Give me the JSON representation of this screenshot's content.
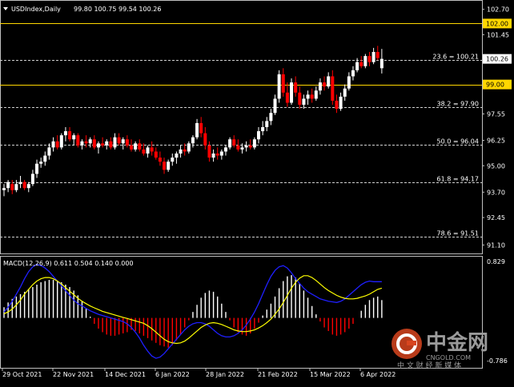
{
  "header": {
    "symbol": "USDIndex,Daily",
    "ohlc": "99.80 100.75 99.54 100.26"
  },
  "macd_header": "MACD(12,26,9) 0.611 0.504 0.140 0.000",
  "colors": {
    "background": "#000000",
    "bull": "#ffffff",
    "bear": "#ff0000",
    "macd_signal": "#ffff00",
    "macd_line": "#1f1fff",
    "level_line": "#ffd700",
    "hist_pos": "#ffffff",
    "hist_neg": "#ff0000"
  },
  "price_axis": {
    "ticks": [
      "102.70",
      "101.45",
      "97.55",
      "96.25",
      "95.00",
      "93.70",
      "92.45",
      "91.10"
    ],
    "current": "100.26",
    "levels": [
      "102.00",
      "99.00"
    ]
  },
  "fib_levels": [
    {
      "label": "23.6 = 100.21",
      "value": 100.21
    },
    {
      "label": "38.2 = 97.90",
      "value": 97.9
    },
    {
      "label": "50.0 = 96.04",
      "value": 96.04
    },
    {
      "label": "61.8 = 94.17",
      "value": 94.17
    },
    {
      "label": "78.6 = 91.51",
      "value": 91.51
    }
  ],
  "macd_axis": {
    "top": "0.829",
    "bottom": "-0.786"
  },
  "date_axis": [
    "29 Oct 2021",
    "22 Nov 2021",
    "14 Dec 2021",
    "6 Jan 2022",
    "28 Jan 2022",
    "21 Feb 2022",
    "15 Mar 2022",
    "6 Apr 2022"
  ],
  "watermark": {
    "name": "中金网",
    "domain": "CNGOLD.COM",
    "tagline": "中 文 财 经 新 媒 体"
  },
  "chart_data": {
    "type": "candlestick",
    "ylim": [
      90.8,
      103.0
    ],
    "candles": [
      [
        93.8,
        94.1,
        93.5,
        93.9
      ],
      [
        93.9,
        94.3,
        93.7,
        94.2
      ],
      [
        94.1,
        94.3,
        93.6,
        93.8
      ],
      [
        93.8,
        94.3,
        93.7,
        94.1
      ],
      [
        94.1,
        94.5,
        93.9,
        94.2
      ],
      [
        94.2,
        94.3,
        93.8,
        93.9
      ],
      [
        93.9,
        94.2,
        93.7,
        94.1
      ],
      [
        94.1,
        94.8,
        94.0,
        94.6
      ],
      [
        94.6,
        95.3,
        94.4,
        95.1
      ],
      [
        95.1,
        95.4,
        94.9,
        95.2
      ],
      [
        95.2,
        95.7,
        95.0,
        95.5
      ],
      [
        95.5,
        96.1,
        95.3,
        95.9
      ],
      [
        95.9,
        96.4,
        95.7,
        96.2
      ],
      [
        96.2,
        96.5,
        95.8,
        95.9
      ],
      [
        95.9,
        96.6,
        95.8,
        96.5
      ],
      [
        96.5,
        96.9,
        96.2,
        96.7
      ],
      [
        96.7,
        96.9,
        96.2,
        96.3
      ],
      [
        96.3,
        96.6,
        96.0,
        96.5
      ],
      [
        96.5,
        96.6,
        95.9,
        96.0
      ],
      [
        96.0,
        96.3,
        95.8,
        96.2
      ],
      [
        96.2,
        96.5,
        95.9,
        96.1
      ],
      [
        96.1,
        96.4,
        95.9,
        96.3
      ],
      [
        96.3,
        96.5,
        95.8,
        95.9
      ],
      [
        95.9,
        96.2,
        95.6,
        96.1
      ],
      [
        96.1,
        96.4,
        95.9,
        96.0
      ],
      [
        96.0,
        96.3,
        95.8,
        96.2
      ],
      [
        96.2,
        96.4,
        95.8,
        95.9
      ],
      [
        95.9,
        96.6,
        95.8,
        96.4
      ],
      [
        96.4,
        96.6,
        96.0,
        96.1
      ],
      [
        96.1,
        96.4,
        95.8,
        96.3
      ],
      [
        96.3,
        96.5,
        95.9,
        96.0
      ],
      [
        96.0,
        96.3,
        95.7,
        95.8
      ],
      [
        95.8,
        96.2,
        95.7,
        96.1
      ],
      [
        96.1,
        96.3,
        95.7,
        95.8
      ],
      [
        95.8,
        96.1,
        95.5,
        95.6
      ],
      [
        95.6,
        96.0,
        95.4,
        95.9
      ],
      [
        95.9,
        96.2,
        95.5,
        95.7
      ],
      [
        95.7,
        95.9,
        95.3,
        95.4
      ],
      [
        95.4,
        95.7,
        95.0,
        95.2
      ],
      [
        95.2,
        95.4,
        94.6,
        94.8
      ],
      [
        94.8,
        95.3,
        94.7,
        95.2
      ],
      [
        95.2,
        95.6,
        95.0,
        95.4
      ],
      [
        95.4,
        95.7,
        95.1,
        95.6
      ],
      [
        95.6,
        96.0,
        95.4,
        95.8
      ],
      [
        95.8,
        96.1,
        95.5,
        95.7
      ],
      [
        95.7,
        96.2,
        95.6,
        96.1
      ],
      [
        96.1,
        96.5,
        95.9,
        96.4
      ],
      [
        96.4,
        97.3,
        96.3,
        97.1
      ],
      [
        97.1,
        97.4,
        96.4,
        96.6
      ],
      [
        96.6,
        96.9,
        95.8,
        96.0
      ],
      [
        96.0,
        96.2,
        95.2,
        95.4
      ],
      [
        95.4,
        95.8,
        95.2,
        95.6
      ],
      [
        95.6,
        95.9,
        95.3,
        95.5
      ],
      [
        95.5,
        95.8,
        95.3,
        95.7
      ],
      [
        95.7,
        96.0,
        95.5,
        95.9
      ],
      [
        95.9,
        96.4,
        95.8,
        96.3
      ],
      [
        96.3,
        96.5,
        95.9,
        96.0
      ],
      [
        96.0,
        96.3,
        95.7,
        95.8
      ],
      [
        95.8,
        96.1,
        95.6,
        95.9
      ],
      [
        95.9,
        96.2,
        95.7,
        96.0
      ],
      [
        96.0,
        96.3,
        95.8,
        95.9
      ],
      [
        95.9,
        96.4,
        95.8,
        96.3
      ],
      [
        96.3,
        96.9,
        96.1,
        96.7
      ],
      [
        96.7,
        97.2,
        96.5,
        96.9
      ],
      [
        96.9,
        97.4,
        96.7,
        97.2
      ],
      [
        97.2,
        97.8,
        97.0,
        97.6
      ],
      [
        97.6,
        98.5,
        97.5,
        98.3
      ],
      [
        98.3,
        99.7,
        98.1,
        99.5
      ],
      [
        99.5,
        99.8,
        98.4,
        98.6
      ],
      [
        98.6,
        99.1,
        97.9,
        98.1
      ],
      [
        98.1,
        99.3,
        98.0,
        99.1
      ],
      [
        99.1,
        99.4,
        98.4,
        98.6
      ],
      [
        98.6,
        98.9,
        97.8,
        98.0
      ],
      [
        98.0,
        98.5,
        97.8,
        98.3
      ],
      [
        98.3,
        98.7,
        98.0,
        98.5
      ],
      [
        98.5,
        98.8,
        98.1,
        98.3
      ],
      [
        98.3,
        98.9,
        98.2,
        98.7
      ],
      [
        98.7,
        99.3,
        98.5,
        99.1
      ],
      [
        99.1,
        99.4,
        98.7,
        98.9
      ],
      [
        98.9,
        99.6,
        98.8,
        99.4
      ],
      [
        99.4,
        99.7,
        98.0,
        98.2
      ],
      [
        98.2,
        98.5,
        97.6,
        97.8
      ],
      [
        97.8,
        98.6,
        97.7,
        98.4
      ],
      [
        98.4,
        99.0,
        98.2,
        98.8
      ],
      [
        98.8,
        99.6,
        98.7,
        99.4
      ],
      [
        99.4,
        99.9,
        99.2,
        99.7
      ],
      [
        99.7,
        100.3,
        99.6,
        100.1
      ],
      [
        100.1,
        100.4,
        99.8,
        99.9
      ],
      [
        99.9,
        100.5,
        99.8,
        100.4
      ],
      [
        100.4,
        100.6,
        99.9,
        100.1
      ],
      [
        100.1,
        100.8,
        100.0,
        100.6
      ],
      [
        100.6,
        100.9,
        100.2,
        100.3
      ],
      [
        99.8,
        100.75,
        99.54,
        100.26
      ]
    ],
    "macd": {
      "histogram": [
        0.18,
        0.26,
        0.32,
        0.36,
        0.4,
        0.44,
        0.48,
        0.52,
        0.56,
        0.6,
        0.62,
        0.64,
        0.64,
        0.62,
        0.6,
        0.56,
        0.52,
        0.46,
        0.38,
        0.28,
        0.16,
        0.02,
        -0.1,
        -0.18,
        -0.24,
        -0.28,
        -0.3,
        -0.3,
        -0.28,
        -0.26,
        -0.24,
        -0.2,
        -0.22,
        -0.26,
        -0.3,
        -0.34,
        -0.38,
        -0.42,
        -0.46,
        -0.48,
        -0.5,
        -0.46,
        -0.38,
        -0.28,
        -0.16,
        -0.04,
        0.1,
        0.22,
        0.34,
        0.42,
        0.46,
        0.44,
        0.36,
        0.24,
        0.1,
        -0.04,
        -0.16,
        -0.24,
        -0.28,
        -0.3,
        -0.26,
        -0.18,
        -0.08,
        0.04,
        0.14,
        0.24,
        0.36,
        0.5,
        0.62,
        0.7,
        0.72,
        0.68,
        0.58,
        0.46,
        0.34,
        0.2,
        0.06,
        -0.06,
        -0.16,
        -0.22,
        -0.28,
        -0.3,
        -0.28,
        -0.24,
        -0.18,
        -0.1,
        0.0,
        0.12,
        0.22,
        0.3,
        0.34,
        0.36,
        0.3
      ],
      "signal": [
        0.07,
        0.1,
        0.15,
        0.22,
        0.3,
        0.4,
        0.48,
        0.56,
        0.62,
        0.66,
        0.68,
        0.68,
        0.66,
        0.62,
        0.57,
        0.51,
        0.45,
        0.39,
        0.33,
        0.28,
        0.24,
        0.2,
        0.17,
        0.14,
        0.11,
        0.09,
        0.07,
        0.05,
        0.03,
        0.01,
        -0.01,
        -0.03,
        -0.05,
        -0.07,
        -0.09,
        -0.13,
        -0.18,
        -0.24,
        -0.3,
        -0.36,
        -0.4,
        -0.42,
        -0.43,
        -0.42,
        -0.39,
        -0.34,
        -0.28,
        -0.22,
        -0.16,
        -0.12,
        -0.09,
        -0.08,
        -0.09,
        -0.11,
        -0.14,
        -0.17,
        -0.2,
        -0.22,
        -0.23,
        -0.23,
        -0.22,
        -0.2,
        -0.17,
        -0.13,
        -0.08,
        -0.02,
        0.06,
        0.15,
        0.26,
        0.38,
        0.5,
        0.6,
        0.67,
        0.71,
        0.71,
        0.68,
        0.63,
        0.57,
        0.51,
        0.46,
        0.42,
        0.38,
        0.35,
        0.33,
        0.32,
        0.32,
        0.33,
        0.35,
        0.37,
        0.4,
        0.44,
        0.48,
        0.5
      ],
      "macd": [
        0.1,
        0.18,
        0.28,
        0.4,
        0.52,
        0.66,
        0.78,
        0.86,
        0.9,
        0.88,
        0.84,
        0.78,
        0.7,
        0.62,
        0.54,
        0.46,
        0.38,
        0.3,
        0.24,
        0.2,
        0.16,
        0.12,
        0.09,
        0.06,
        0.04,
        0.02,
        0.0,
        -0.02,
        -0.04,
        -0.06,
        -0.1,
        -0.16,
        -0.24,
        -0.34,
        -0.46,
        -0.56,
        -0.64,
        -0.68,
        -0.66,
        -0.6,
        -0.52,
        -0.44,
        -0.36,
        -0.28,
        -0.2,
        -0.14,
        -0.1,
        -0.08,
        -0.08,
        -0.1,
        -0.14,
        -0.2,
        -0.26,
        -0.3,
        -0.32,
        -0.32,
        -0.3,
        -0.26,
        -0.2,
        -0.12,
        -0.02,
        0.1,
        0.24,
        0.4,
        0.56,
        0.7,
        0.8,
        0.86,
        0.88,
        0.84,
        0.76,
        0.66,
        0.58,
        0.5,
        0.44,
        0.4,
        0.36,
        0.32,
        0.3,
        0.28,
        0.27,
        0.26,
        0.28,
        0.32,
        0.38,
        0.44,
        0.5,
        0.56,
        0.6,
        0.62,
        0.61,
        0.61,
        0.61
      ]
    },
    "macd_ylim": [
      -0.786,
      0.829
    ]
  }
}
